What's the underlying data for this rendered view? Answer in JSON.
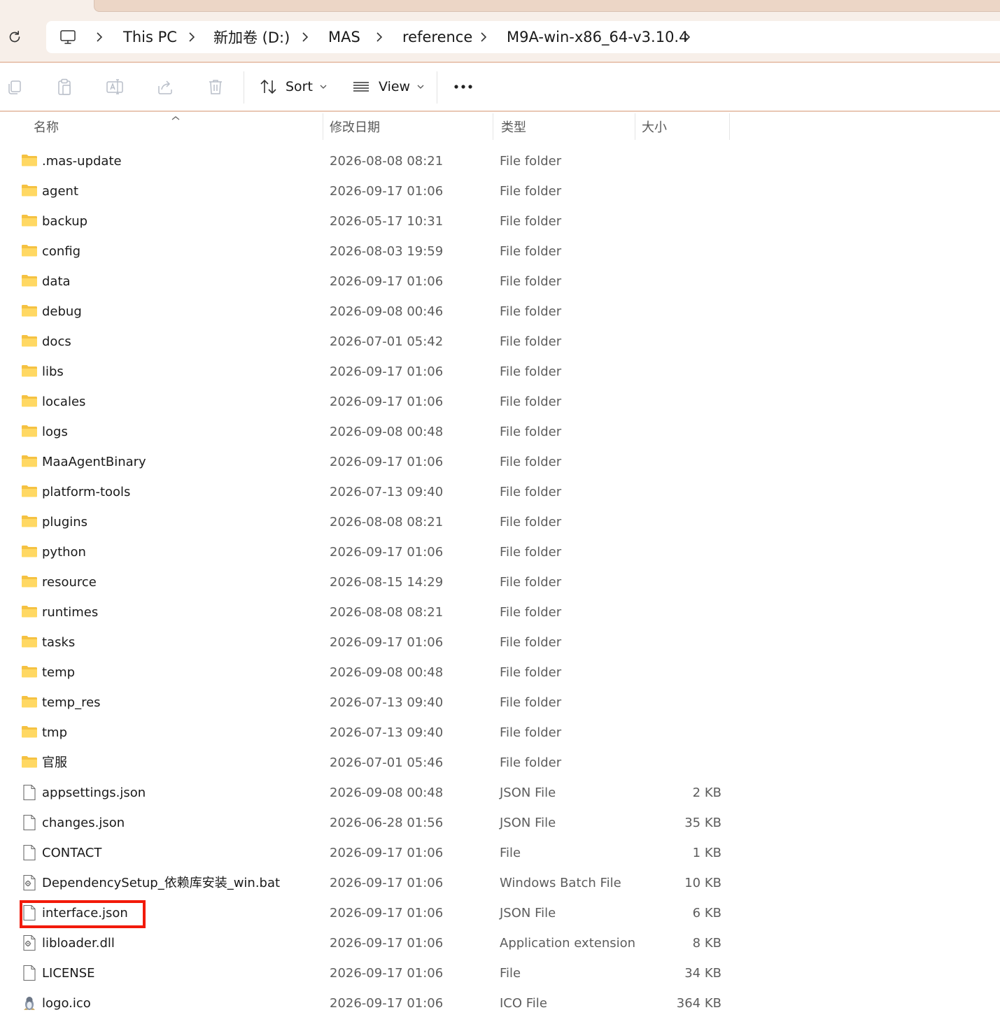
{
  "breadcrumbs": [
    "This PC",
    "新加卷 (D:)",
    "MAS",
    "reference",
    "M9A-win-x86_64-v3.10.4"
  ],
  "toolbar": {
    "sort_label": "Sort",
    "view_label": "View"
  },
  "columns": {
    "name": "名称",
    "date": "修改日期",
    "type": "类型",
    "size": "大小"
  },
  "files": [
    {
      "name": ".mas-update",
      "date": "2026-08-08 08:21",
      "type": "File folder",
      "size": "",
      "icon": "folder-icon"
    },
    {
      "name": "agent",
      "date": "2026-09-17 01:06",
      "type": "File folder",
      "size": "",
      "icon": "folder-icon"
    },
    {
      "name": "backup",
      "date": "2026-05-17 10:31",
      "type": "File folder",
      "size": "",
      "icon": "folder-icon"
    },
    {
      "name": "config",
      "date": "2026-08-03 19:59",
      "type": "File folder",
      "size": "",
      "icon": "folder-icon"
    },
    {
      "name": "data",
      "date": "2026-09-17 01:06",
      "type": "File folder",
      "size": "",
      "icon": "folder-icon"
    },
    {
      "name": "debug",
      "date": "2026-09-08 00:46",
      "type": "File folder",
      "size": "",
      "icon": "folder-icon"
    },
    {
      "name": "docs",
      "date": "2026-07-01 05:42",
      "type": "File folder",
      "size": "",
      "icon": "folder-icon"
    },
    {
      "name": "libs",
      "date": "2026-09-17 01:06",
      "type": "File folder",
      "size": "",
      "icon": "folder-icon"
    },
    {
      "name": "locales",
      "date": "2026-09-17 01:06",
      "type": "File folder",
      "size": "",
      "icon": "folder-icon"
    },
    {
      "name": "logs",
      "date": "2026-09-08 00:48",
      "type": "File folder",
      "size": "",
      "icon": "folder-icon"
    },
    {
      "name": "MaaAgentBinary",
      "date": "2026-09-17 01:06",
      "type": "File folder",
      "size": "",
      "icon": "folder-icon"
    },
    {
      "name": "platform-tools",
      "date": "2026-07-13 09:40",
      "type": "File folder",
      "size": "",
      "icon": "folder-icon"
    },
    {
      "name": "plugins",
      "date": "2026-08-08 08:21",
      "type": "File folder",
      "size": "",
      "icon": "folder-icon"
    },
    {
      "name": "python",
      "date": "2026-09-17 01:06",
      "type": "File folder",
      "size": "",
      "icon": "folder-icon"
    },
    {
      "name": "resource",
      "date": "2026-08-15 14:29",
      "type": "File folder",
      "size": "",
      "icon": "folder-icon"
    },
    {
      "name": "runtimes",
      "date": "2026-08-08 08:21",
      "type": "File folder",
      "size": "",
      "icon": "folder-icon"
    },
    {
      "name": "tasks",
      "date": "2026-09-17 01:06",
      "type": "File folder",
      "size": "",
      "icon": "folder-icon"
    },
    {
      "name": "temp",
      "date": "2026-09-08 00:48",
      "type": "File folder",
      "size": "",
      "icon": "folder-icon"
    },
    {
      "name": "temp_res",
      "date": "2026-07-13 09:40",
      "type": "File folder",
      "size": "",
      "icon": "folder-icon"
    },
    {
      "name": "tmp",
      "date": "2026-07-13 09:40",
      "type": "File folder",
      "size": "",
      "icon": "folder-icon"
    },
    {
      "name": "官服",
      "date": "2026-07-01 05:46",
      "type": "File folder",
      "size": "",
      "icon": "folder-icon"
    },
    {
      "name": "appsettings.json",
      "date": "2026-09-08 00:48",
      "type": "JSON File",
      "size": "2 KB",
      "icon": "file-icon"
    },
    {
      "name": "changes.json",
      "date": "2026-06-28 01:56",
      "type": "JSON File",
      "size": "35 KB",
      "icon": "file-icon"
    },
    {
      "name": "CONTACT",
      "date": "2026-09-17 01:06",
      "type": "File",
      "size": "1 KB",
      "icon": "file-icon"
    },
    {
      "name": "DependencySetup_依赖库安装_win.bat",
      "date": "2026-09-17 01:06",
      "type": "Windows Batch File",
      "size": "10 KB",
      "icon": "gear-file-icon"
    },
    {
      "name": "interface.json",
      "date": "2026-09-17 01:06",
      "type": "JSON File",
      "size": "6 KB",
      "icon": "file-icon"
    },
    {
      "name": "libloader.dll",
      "date": "2026-09-17 01:06",
      "type": "Application extension",
      "size": "8 KB",
      "icon": "gear-file-icon"
    },
    {
      "name": "LICENSE",
      "date": "2026-09-17 01:06",
      "type": "File",
      "size": "34 KB",
      "icon": "file-icon"
    },
    {
      "name": "logo.ico",
      "date": "2026-09-17 01:06",
      "type": "ICO File",
      "size": "364 KB",
      "icon": "image-file-icon"
    }
  ],
  "colors": {
    "highlight": "#f21a0a",
    "folder": "#f5c242",
    "accent_line": "#e9c7b4"
  }
}
